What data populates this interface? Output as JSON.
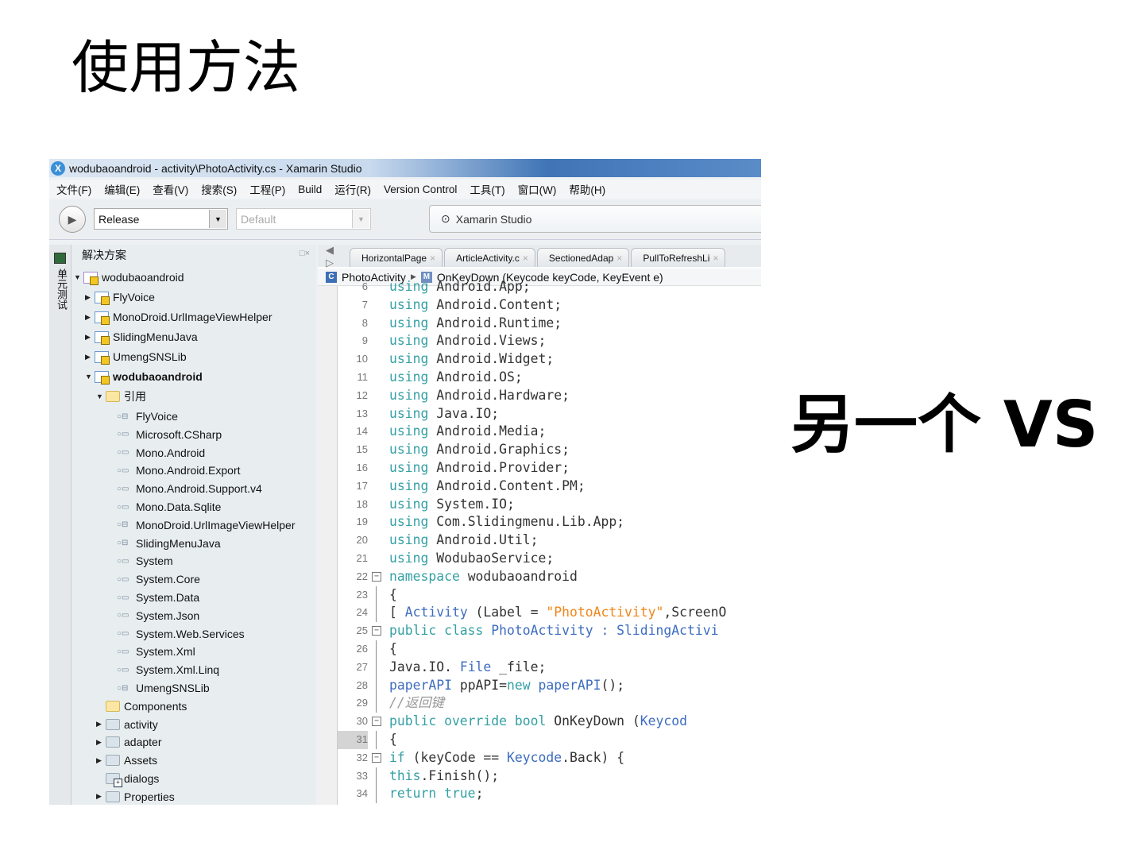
{
  "slide": {
    "title": "使用方法",
    "side_text": "另一个 VS"
  },
  "window": {
    "title": "wodubaoandroid - activity\\PhotoActivity.cs - Xamarin Studio",
    "app_icon": "xamarin-icon"
  },
  "menu": [
    "文件(F)",
    "编辑(E)",
    "查看(V)",
    "搜索(S)",
    "工程(P)",
    "Build",
    "运行(R)",
    "Version Control",
    "工具(T)",
    "窗口(W)",
    "帮助(H)"
  ],
  "toolbar": {
    "config": "Release",
    "platform": "Default",
    "status": "Xamarin Studio"
  },
  "side_tab": "单元测试",
  "solution": {
    "header": "解决方案",
    "header_buttons": "□×",
    "items": [
      {
        "label": "wodubaoandroid",
        "depth": 0,
        "icon": "project",
        "tw": "▼",
        "root": true
      },
      {
        "label": "FlyVoice",
        "depth": 1,
        "icon": "project",
        "tw": "▶"
      },
      {
        "label": "MonoDroid.UrlImageViewHelper",
        "depth": 1,
        "icon": "project",
        "tw": "▶"
      },
      {
        "label": "SlidingMenuJava",
        "depth": 1,
        "icon": "project",
        "tw": "▶"
      },
      {
        "label": "UmengSNSLib",
        "depth": 1,
        "icon": "project",
        "tw": "▶"
      },
      {
        "label": "wodubaoandroid",
        "depth": 1,
        "icon": "project",
        "tw": "▼",
        "bold": true
      },
      {
        "label": "引用",
        "depth": 2,
        "icon": "folder-yellow",
        "tw": "▼"
      },
      {
        "label": "FlyVoice",
        "depth": 3,
        "icon": "project-ref"
      },
      {
        "label": "Microsoft.CSharp",
        "depth": 3,
        "icon": "assembly-ref"
      },
      {
        "label": "Mono.Android",
        "depth": 3,
        "icon": "assembly-ref"
      },
      {
        "label": "Mono.Android.Export",
        "depth": 3,
        "icon": "assembly-ref"
      },
      {
        "label": "Mono.Android.Support.v4",
        "depth": 3,
        "icon": "assembly-ref"
      },
      {
        "label": "Mono.Data.Sqlite",
        "depth": 3,
        "icon": "assembly-ref"
      },
      {
        "label": "MonoDroid.UrlImageViewHelper",
        "depth": 3,
        "icon": "project-ref"
      },
      {
        "label": "SlidingMenuJava",
        "depth": 3,
        "icon": "project-ref"
      },
      {
        "label": "System",
        "depth": 3,
        "icon": "assembly-ref"
      },
      {
        "label": "System.Core",
        "depth": 3,
        "icon": "assembly-ref"
      },
      {
        "label": "System.Data",
        "depth": 3,
        "icon": "assembly-ref"
      },
      {
        "label": "System.Json",
        "depth": 3,
        "icon": "assembly-ref"
      },
      {
        "label": "System.Web.Services",
        "depth": 3,
        "icon": "assembly-ref"
      },
      {
        "label": "System.Xml",
        "depth": 3,
        "icon": "assembly-ref"
      },
      {
        "label": "System.Xml.Linq",
        "depth": 3,
        "icon": "assembly-ref"
      },
      {
        "label": "UmengSNSLib",
        "depth": 3,
        "icon": "project-ref"
      },
      {
        "label": "Components",
        "depth": 2,
        "icon": "folder-yellow"
      },
      {
        "label": "activity",
        "depth": 2,
        "icon": "folder",
        "tw": "▶"
      },
      {
        "label": "adapter",
        "depth": 2,
        "icon": "folder",
        "tw": "▶"
      },
      {
        "label": "Assets",
        "depth": 2,
        "icon": "folder",
        "tw": "▶"
      },
      {
        "label": "dialogs",
        "depth": 2,
        "icon": "folder-add"
      },
      {
        "label": "Properties",
        "depth": 2,
        "icon": "folder",
        "tw": "▶"
      }
    ]
  },
  "editor": {
    "tabs": [
      "HorizontalPage",
      "ArticleActivity.c",
      "SectionedAdap",
      "PullToRefreshLi"
    ],
    "breadcrumb": {
      "class": "PhotoActivity",
      "method": "OnKeyDown (Keycode keyCode, KeyEvent e)"
    },
    "current_line": 31,
    "lines": [
      {
        "n": 6,
        "s": [
          [
            "kw",
            "using"
          ],
          [
            "",
            "Android.App;"
          ]
        ]
      },
      {
        "n": 7,
        "s": [
          [
            "kw",
            "using"
          ],
          [
            "",
            "Android.Content;"
          ]
        ]
      },
      {
        "n": 8,
        "s": [
          [
            "kw",
            "using"
          ],
          [
            "",
            "Android.Runtime;"
          ]
        ]
      },
      {
        "n": 9,
        "s": [
          [
            "kw",
            "using"
          ],
          [
            "",
            "Android.Views;"
          ]
        ]
      },
      {
        "n": 10,
        "s": [
          [
            "kw",
            "using"
          ],
          [
            "",
            "Android.Widget;"
          ]
        ]
      },
      {
        "n": 11,
        "s": [
          [
            "kw",
            "using"
          ],
          [
            "",
            "Android.OS;"
          ]
        ]
      },
      {
        "n": 12,
        "s": [
          [
            "kw",
            "using"
          ],
          [
            "",
            "Android.Hardware;"
          ]
        ]
      },
      {
        "n": 13,
        "s": [
          [
            "kw",
            "using"
          ],
          [
            "",
            "Java.IO;"
          ]
        ]
      },
      {
        "n": 14,
        "s": [
          [
            "kw",
            "using"
          ],
          [
            "",
            "Android.Media;"
          ]
        ]
      },
      {
        "n": 15,
        "s": [
          [
            "kw",
            "using"
          ],
          [
            "",
            "Android.Graphics;"
          ]
        ]
      },
      {
        "n": 16,
        "s": [
          [
            "kw",
            "using"
          ],
          [
            "",
            "Android.Provider;"
          ]
        ]
      },
      {
        "n": 17,
        "s": [
          [
            "kw",
            "using"
          ],
          [
            "",
            "Android.Content.PM;"
          ]
        ]
      },
      {
        "n": 18,
        "s": [
          [
            "kw",
            "using"
          ],
          [
            "",
            "System.IO;"
          ]
        ]
      },
      {
        "n": 19,
        "s": [
          [
            "kw",
            "using"
          ],
          [
            "",
            "Com.Slidingmenu.Lib.App;"
          ]
        ]
      },
      {
        "n": 20,
        "s": [
          [
            "kw",
            "using"
          ],
          [
            "",
            "Android.Util;"
          ]
        ]
      },
      {
        "n": 21,
        "s": [
          [
            "kw",
            "using"
          ],
          [
            "",
            "WodubaoService;"
          ]
        ]
      },
      {
        "n": 22,
        "fold": true,
        "s": [
          [
            "kw",
            "namespace"
          ],
          [
            "",
            "wodubaoandroid"
          ]
        ]
      },
      {
        "n": 23,
        "s": [
          [
            "",
            "{"
          ]
        ]
      },
      {
        "n": 24,
        "s": [
          [
            "",
            "    ["
          ],
          [
            "ty",
            "Activity"
          ],
          [
            "",
            " (Label = "
          ],
          [
            "st",
            "\"PhotoActivity\""
          ],
          [
            "",
            ",ScreenO"
          ]
        ]
      },
      {
        "n": 25,
        "fold": true,
        "s": [
          [
            "kw",
            "    public class"
          ],
          [
            "ty",
            "PhotoActivity"
          ],
          [
            "ty",
            ": SlidingActivi"
          ]
        ]
      },
      {
        "n": 26,
        "s": [
          [
            "",
            "    {"
          ]
        ]
      },
      {
        "n": 27,
        "s": [
          [
            "",
            "        Java.IO."
          ],
          [
            "ty",
            "File"
          ],
          [
            "",
            " _file;"
          ]
        ]
      },
      {
        "n": 28,
        "s": [
          [
            "ty",
            "        paperAPI"
          ],
          [
            "",
            " ppAPI="
          ],
          [
            "kw",
            "new"
          ],
          [
            "ty",
            "paperAPI"
          ],
          [
            "",
            "();"
          ]
        ]
      },
      {
        "n": 29,
        "s": [
          [
            "cm",
            "        //返回键"
          ]
        ]
      },
      {
        "n": 30,
        "fold": true,
        "s": [
          [
            "kw",
            "        public override bool"
          ],
          [
            "",
            "OnKeyDown ("
          ],
          [
            "ty",
            "Keycod"
          ]
        ]
      },
      {
        "n": 31,
        "s": [
          [
            "",
            "        {"
          ]
        ]
      },
      {
        "n": 32,
        "fold": true,
        "s": [
          [
            "kw",
            "            if"
          ],
          [
            "",
            " (keyCode == "
          ],
          [
            "ty",
            "Keycode"
          ],
          [
            "",
            ".Back) {"
          ]
        ]
      },
      {
        "n": 33,
        "s": [
          [
            "kw",
            "                this"
          ],
          [
            "",
            ".Finish();"
          ]
        ]
      },
      {
        "n": 34,
        "s": [
          [
            "kw",
            "                return true"
          ],
          [
            "",
            ";"
          ]
        ]
      }
    ]
  },
  "colors": {
    "keyword": "#34a0a4",
    "type": "#3d6cc0",
    "string": "#f0861a",
    "comment": "#999999"
  }
}
